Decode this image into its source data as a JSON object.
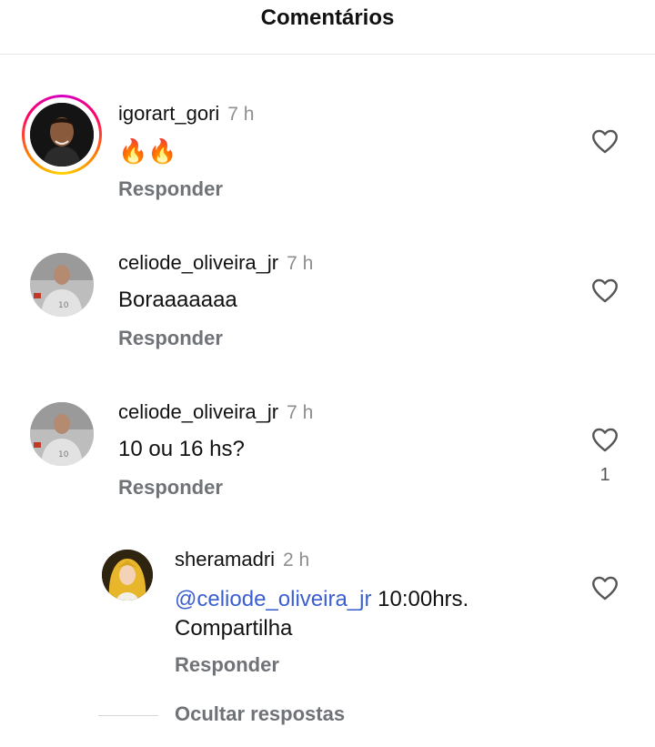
{
  "header": {
    "title": "Comentários"
  },
  "comments": [
    {
      "username": "igorart_gori",
      "time": "7 h",
      "text": "🔥🔥",
      "reply_label": "Responder",
      "likes": ""
    },
    {
      "username": "celiode_oliveira_jr",
      "time": "7 h",
      "text": "Boraaaaaaa",
      "reply_label": "Responder",
      "likes": ""
    },
    {
      "username": "celiode_oliveira_jr",
      "time": "7 h",
      "text": "10 ou 16 hs?",
      "reply_label": "Responder",
      "likes": "1"
    }
  ],
  "reply": {
    "username": "sheramadri",
    "time": "2 h",
    "mention": "@celiode_oliveira_jr",
    "text_after_mention": " 10:00hrs.",
    "text_line2": "Compartilha",
    "reply_label": "Responder"
  },
  "hide_replies_label": "Ocultar respostas",
  "icons": {
    "like": "heart-outline-icon"
  },
  "colors": {
    "mention": "#3b5fd0",
    "muted": "#6f7377",
    "time": "#8e8e8e"
  }
}
